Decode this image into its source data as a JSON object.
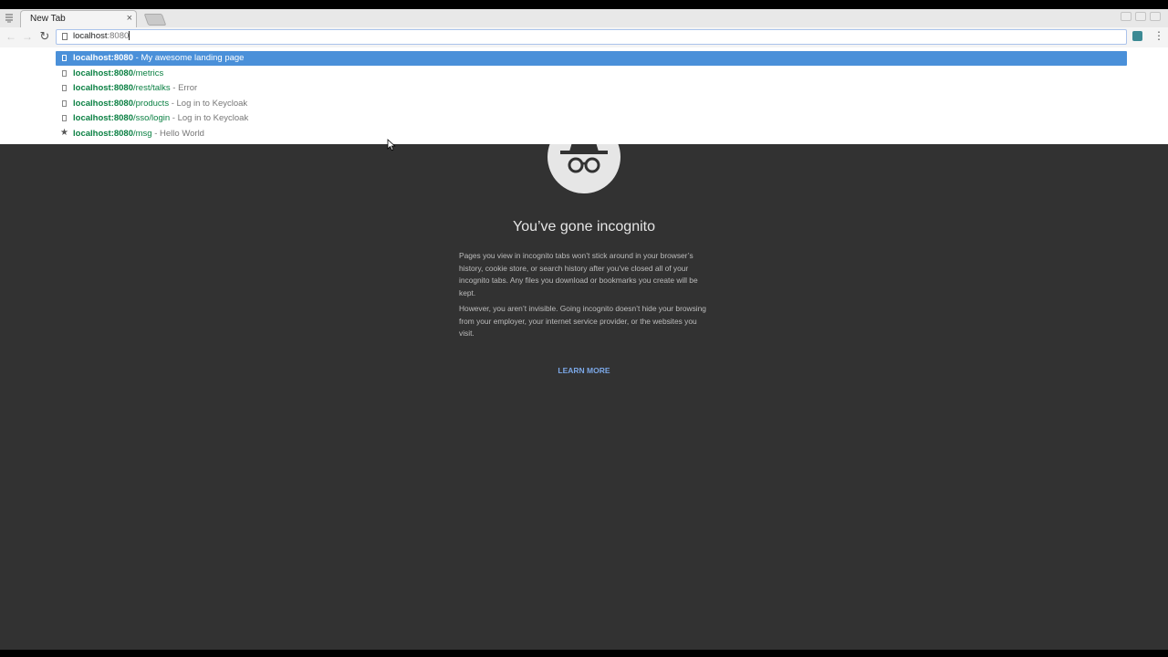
{
  "tab": {
    "title": "New Tab",
    "close_glyph": "×"
  },
  "toolbar": {
    "back_glyph": "←",
    "forward_glyph": "→",
    "reload_glyph": "↻",
    "kebab_glyph": "⋮",
    "omnibox_typed": "localhost",
    "omnibox_autocomplete": ":8080"
  },
  "suggestions": [
    {
      "icon": "page-icon",
      "url_bold": "localhost:8080",
      "url_rest": "",
      "title": " - My awesome landing page",
      "active": true
    },
    {
      "icon": "page-icon",
      "url_bold": "localhost:8080",
      "url_rest": "/metrics",
      "title": ""
    },
    {
      "icon": "page-icon",
      "url_bold": "localhost:8080",
      "url_rest": "/rest/talks",
      "title": " - Error"
    },
    {
      "icon": "page-icon",
      "url_bold": "localhost:8080",
      "url_rest": "/products",
      "title": " - Log in to Keycloak"
    },
    {
      "icon": "page-icon",
      "url_bold": "localhost:8080",
      "url_rest": "/sso/login",
      "title": " - Log in to Keycloak"
    },
    {
      "icon": "star-icon",
      "url_bold": "localhost:8080",
      "url_rest": "/msg",
      "title": " - Hello World"
    }
  ],
  "incognito": {
    "headline": "You’ve gone incognito",
    "para1": "Pages you view in incognito tabs won’t stick around in your browser’s history, cookie store, or search history after you’ve closed all of your incognito tabs. Any files you download or bookmarks you create will be kept.",
    "para2": "However, you aren’t invisible. Going incognito doesn’t hide your browsing from your employer, your internet service provider, or the websites you visit.",
    "learn_more": "LEARN MORE"
  },
  "colors": {
    "accent": "#4a90d9",
    "url_green": "#0b8043",
    "content_bg": "#323232",
    "link_blue": "#7ba7e6"
  }
}
